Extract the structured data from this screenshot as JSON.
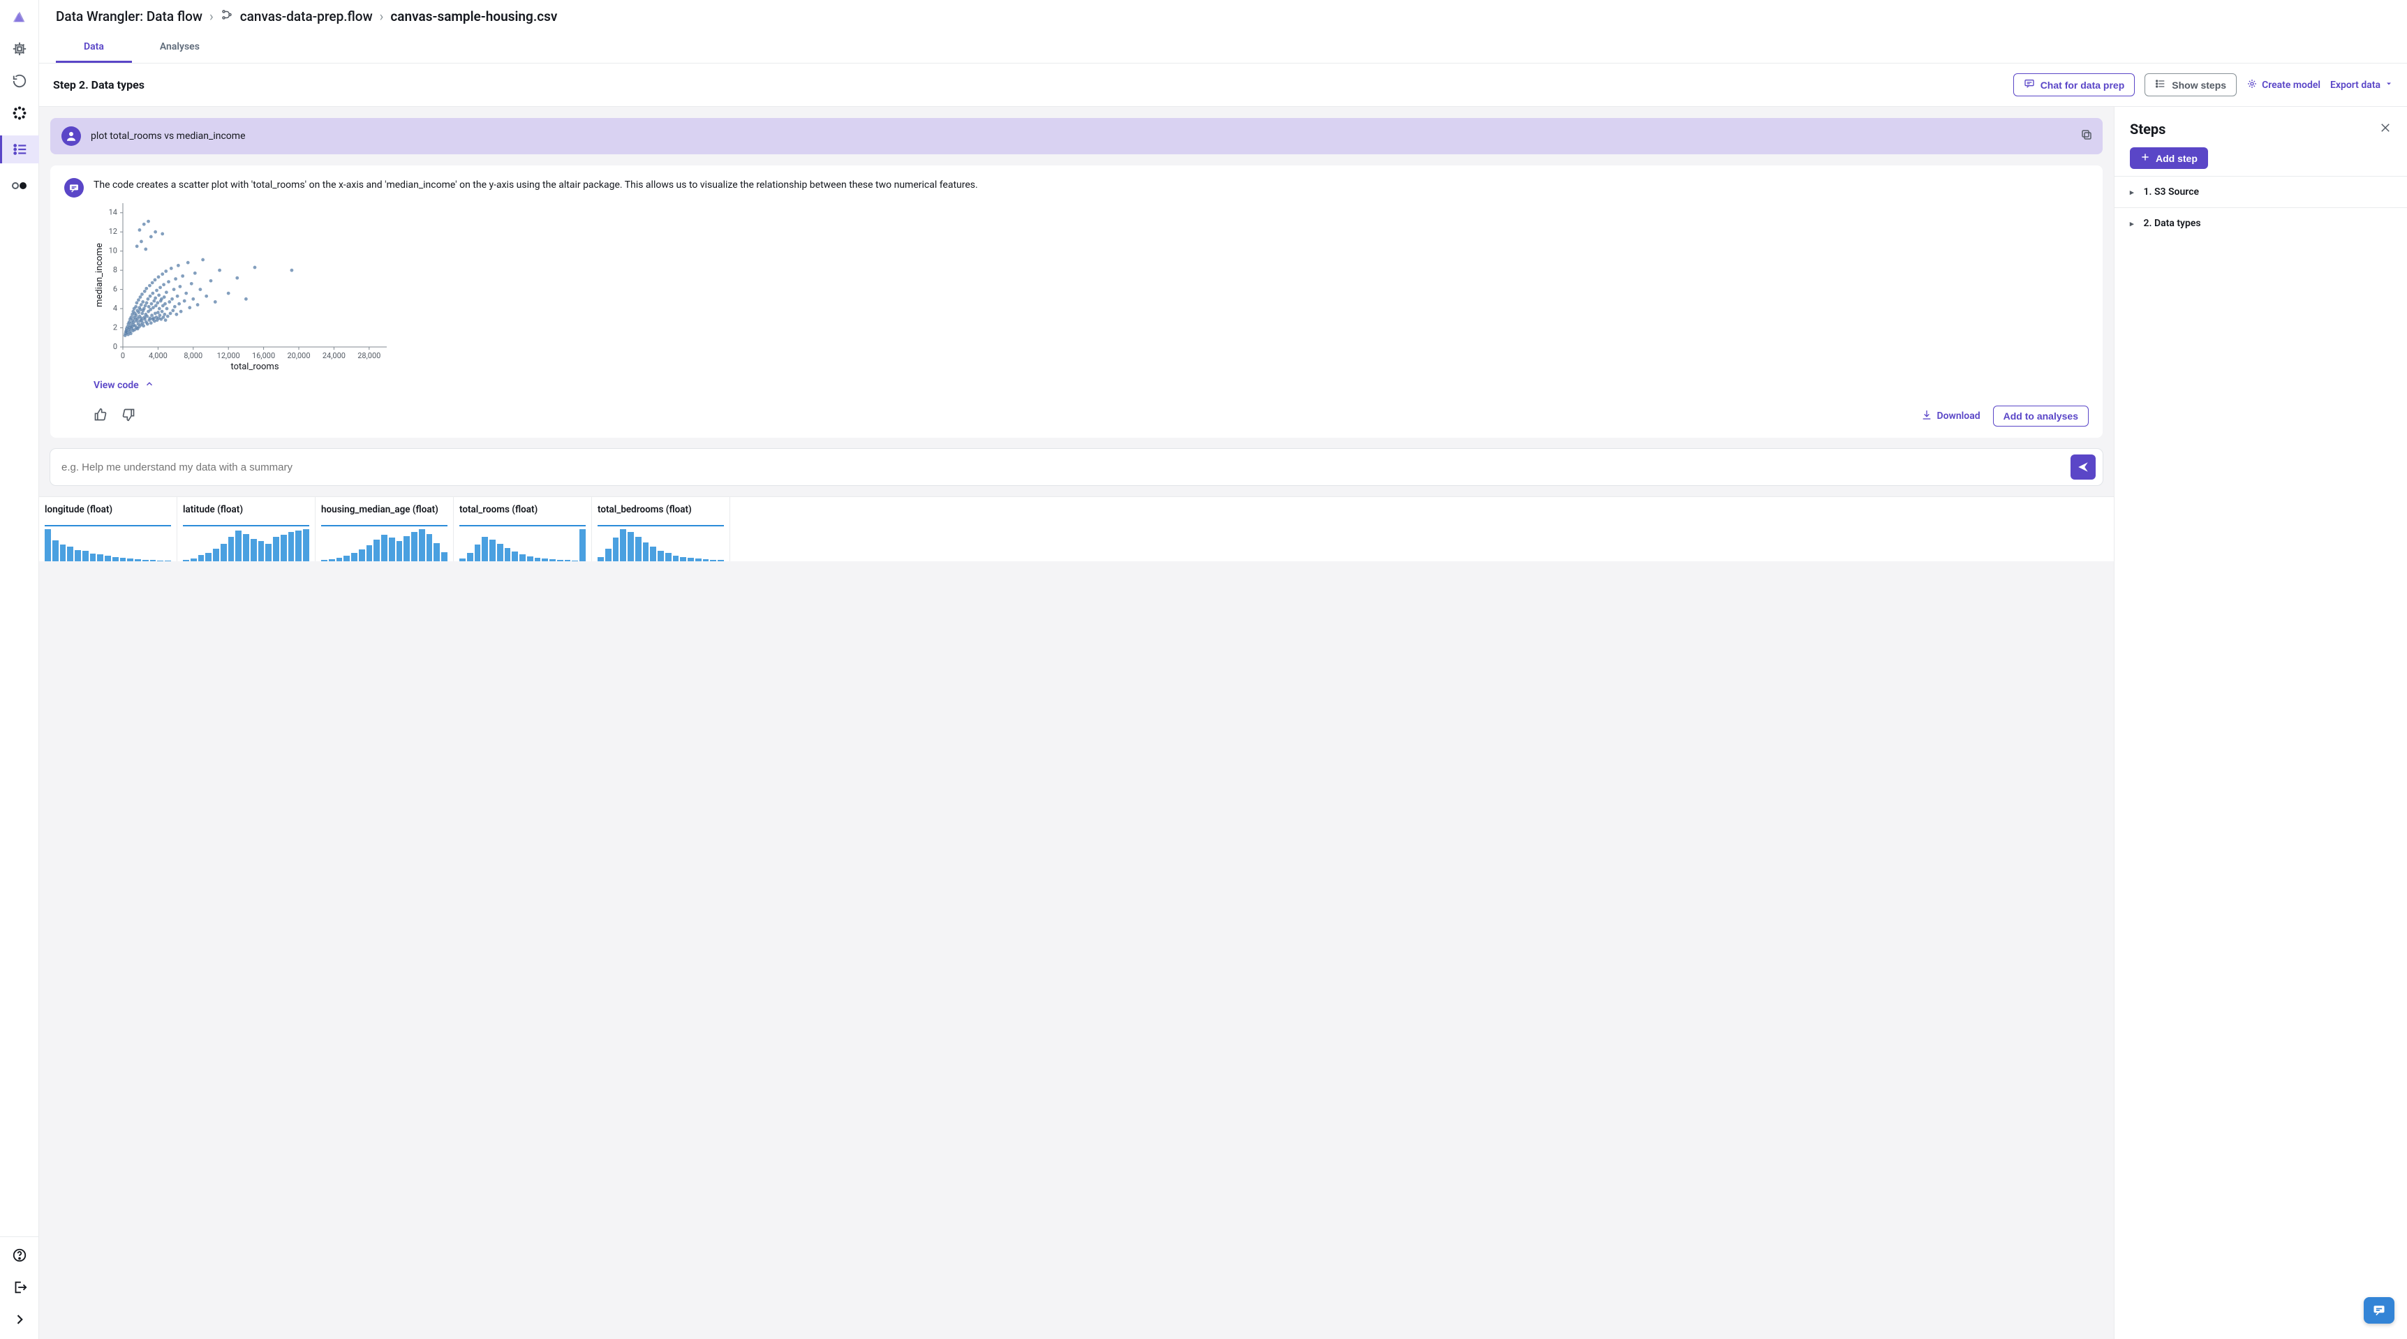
{
  "breadcrumb": {
    "root": "Data Wrangler: Data flow",
    "flow": "canvas-data-prep.flow",
    "file": "canvas-sample-housing.csv"
  },
  "tabs": {
    "data": "Data",
    "analyses": "Analyses"
  },
  "toolbar": {
    "title": "Step 2. Data types",
    "chat": "Chat for data prep",
    "show_steps": "Show steps",
    "create_model": "Create model",
    "export": "Export data"
  },
  "chat": {
    "user_message": "plot total_rooms vs median_income",
    "bot_message": "The code creates a scatter plot with 'total_rooms' on the x-axis and 'median_income' on the y-axis using the altair package. This allows us to visualize the relationship between these two numerical features.",
    "view_code": "View code",
    "download": "Download",
    "add_to_analyses": "Add to analyses",
    "placeholder": "e.g. Help me understand my data with a summary"
  },
  "chart_data": {
    "type": "scatter",
    "xlabel": "total_rooms",
    "ylabel": "median_income",
    "xlim": [
      0,
      30000
    ],
    "ylim": [
      0,
      15
    ],
    "x_ticks": [
      0,
      4000,
      8000,
      12000,
      16000,
      20000,
      24000,
      28000
    ],
    "y_ticks": [
      0,
      2,
      4,
      6,
      8,
      10,
      12,
      14
    ],
    "x_tick_labels": [
      "0",
      "4,000",
      "8,000",
      "12,000",
      "16,000",
      "20,000",
      "24,000",
      "28,000"
    ],
    "point_color": "#5a7fa8",
    "points": [
      [
        250,
        1.2
      ],
      [
        300,
        1.4
      ],
      [
        350,
        1.6
      ],
      [
        400,
        1.7
      ],
      [
        420,
        1.9
      ],
      [
        500,
        1.5
      ],
      [
        520,
        2.1
      ],
      [
        600,
        1.3
      ],
      [
        620,
        2.4
      ],
      [
        700,
        1.8
      ],
      [
        720,
        2.6
      ],
      [
        750,
        2.0
      ],
      [
        800,
        1.6
      ],
      [
        820,
        2.9
      ],
      [
        850,
        2.2
      ],
      [
        900,
        1.4
      ],
      [
        940,
        3.1
      ],
      [
        980,
        2.5
      ],
      [
        1000,
        1.9
      ],
      [
        1050,
        2.1
      ],
      [
        1080,
        3.4
      ],
      [
        1100,
        2.8
      ],
      [
        1150,
        1.7
      ],
      [
        1180,
        3.7
      ],
      [
        1200,
        2.3
      ],
      [
        1250,
        2.6
      ],
      [
        1280,
        4.0
      ],
      [
        1300,
        3.1
      ],
      [
        1350,
        1.8
      ],
      [
        1380,
        3.5
      ],
      [
        1400,
        2.2
      ],
      [
        1450,
        2.9
      ],
      [
        1480,
        4.2
      ],
      [
        1500,
        3.3
      ],
      [
        1550,
        2.0
      ],
      [
        1580,
        4.6
      ],
      [
        1600,
        2.7
      ],
      [
        1650,
        3.8
      ],
      [
        1680,
        1.9
      ],
      [
        1700,
        3.0
      ],
      [
        1750,
        2.4
      ],
      [
        1780,
        4.9
      ],
      [
        1800,
        3.6
      ],
      [
        1850,
        2.1
      ],
      [
        1880,
        4.1
      ],
      [
        1900,
        3.2
      ],
      [
        1950,
        2.7
      ],
      [
        1980,
        5.2
      ],
      [
        2000,
        3.9
      ],
      [
        2050,
        2.3
      ],
      [
        2080,
        4.4
      ],
      [
        2100,
        3.0
      ],
      [
        2150,
        2.8
      ],
      [
        2180,
        5.5
      ],
      [
        2200,
        3.5
      ],
      [
        2250,
        2.5
      ],
      [
        2280,
        4.7
      ],
      [
        2300,
        3.8
      ],
      [
        2350,
        2.2
      ],
      [
        2400,
        4.0
      ],
      [
        2450,
        3.1
      ],
      [
        2480,
        5.8
      ],
      [
        2500,
        2.9
      ],
      [
        2550,
        4.3
      ],
      [
        2600,
        3.4
      ],
      [
        2650,
        2.6
      ],
      [
        2680,
        6.1
      ],
      [
        2700,
        4.6
      ],
      [
        2750,
        3.2
      ],
      [
        2800,
        2.4
      ],
      [
        2850,
        5.0
      ],
      [
        2900,
        3.7
      ],
      [
        2950,
        4.2
      ],
      [
        3000,
        2.8
      ],
      [
        3050,
        6.4
      ],
      [
        3080,
        3.0
      ],
      [
        3100,
        5.3
      ],
      [
        3150,
        3.9
      ],
      [
        3200,
        2.5
      ],
      [
        3250,
        4.5
      ],
      [
        3300,
        3.3
      ],
      [
        3350,
        6.7
      ],
      [
        3380,
        2.9
      ],
      [
        3400,
        5.6
      ],
      [
        3450,
        4.1
      ],
      [
        3500,
        3.0
      ],
      [
        3550,
        4.8
      ],
      [
        3600,
        2.7
      ],
      [
        3650,
        7.0
      ],
      [
        3680,
        3.5
      ],
      [
        3700,
        5.1
      ],
      [
        3750,
        4.3
      ],
      [
        3800,
        3.1
      ],
      [
        3850,
        5.9
      ],
      [
        3900,
        2.8
      ],
      [
        3950,
        4.6
      ],
      [
        4000,
        3.6
      ],
      [
        4050,
        7.3
      ],
      [
        4080,
        3.0
      ],
      [
        4100,
        5.4
      ],
      [
        4150,
        4.0
      ],
      [
        4200,
        3.3
      ],
      [
        4250,
        6.2
      ],
      [
        4300,
        4.8
      ],
      [
        4350,
        2.9
      ],
      [
        4400,
        5.0
      ],
      [
        4450,
        3.7
      ],
      [
        4500,
        7.6
      ],
      [
        4550,
        4.3
      ],
      [
        4600,
        3.1
      ],
      [
        4650,
        6.5
      ],
      [
        4700,
        5.2
      ],
      [
        4750,
        3.4
      ],
      [
        4800,
        4.5
      ],
      [
        4850,
        2.8
      ],
      [
        4900,
        7.9
      ],
      [
        4950,
        5.7
      ],
      [
        5000,
        4.0
      ],
      [
        5100,
        3.2
      ],
      [
        5200,
        6.8
      ],
      [
        5300,
        4.7
      ],
      [
        5400,
        3.5
      ],
      [
        5500,
        8.2
      ],
      [
        5600,
        5.0
      ],
      [
        5700,
        3.8
      ],
      [
        5800,
        6.0
      ],
      [
        5900,
        4.2
      ],
      [
        6000,
        7.1
      ],
      [
        6100,
        3.4
      ],
      [
        6200,
        5.3
      ],
      [
        6300,
        8.5
      ],
      [
        6400,
        4.5
      ],
      [
        6500,
        6.3
      ],
      [
        6600,
        3.7
      ],
      [
        6800,
        7.4
      ],
      [
        7000,
        4.8
      ],
      [
        7200,
        5.6
      ],
      [
        7400,
        8.8
      ],
      [
        7600,
        4.1
      ],
      [
        7800,
        6.6
      ],
      [
        8000,
        5.0
      ],
      [
        8200,
        7.7
      ],
      [
        8500,
        4.4
      ],
      [
        8800,
        6.0
      ],
      [
        9100,
        9.1
      ],
      [
        9500,
        5.3
      ],
      [
        10000,
        6.9
      ],
      [
        10500,
        4.7
      ],
      [
        11000,
        8.0
      ],
      [
        12000,
        5.6
      ],
      [
        13000,
        7.2
      ],
      [
        14000,
        5.0
      ],
      [
        15000,
        8.3
      ],
      [
        1600,
        10.5
      ],
      [
        1900,
        12.2
      ],
      [
        2100,
        11.0
      ],
      [
        2400,
        12.8
      ],
      [
        2600,
        10.2
      ],
      [
        2900,
        13.1
      ],
      [
        3200,
        11.5
      ],
      [
        3700,
        12.0
      ],
      [
        4500,
        11.8
      ],
      [
        19200,
        8.0
      ]
    ]
  },
  "columns": [
    {
      "name": "longitude (float)",
      "hist": [
        72,
        48,
        38,
        34,
        26,
        24,
        18,
        16,
        13,
        10,
        8,
        6,
        5,
        4,
        3,
        2,
        2
      ]
    },
    {
      "name": "latitude (float)",
      "hist": [
        4,
        6,
        14,
        20,
        28,
        40,
        55,
        70,
        62,
        50,
        46,
        40,
        55,
        60,
        66,
        70,
        72
      ]
    },
    {
      "name": "housing_median_age (float)",
      "hist": [
        3,
        5,
        8,
        12,
        18,
        26,
        36,
        48,
        58,
        52,
        44,
        56,
        64,
        70,
        60,
        40,
        20
      ]
    },
    {
      "name": "total_rooms (float)",
      "hist": [
        8,
        24,
        48,
        70,
        62,
        50,
        38,
        28,
        20,
        14,
        10,
        8,
        6,
        5,
        4,
        3,
        92
      ]
    },
    {
      "name": "total_bedrooms (float)",
      "hist": [
        10,
        28,
        52,
        70,
        64,
        54,
        42,
        32,
        24,
        18,
        13,
        10,
        8,
        6,
        5,
        4,
        3
      ]
    }
  ],
  "steps": {
    "title": "Steps",
    "add_btn": "Add step",
    "items": [
      {
        "label": "1. S3 Source"
      },
      {
        "label": "2. Data types"
      }
    ]
  }
}
